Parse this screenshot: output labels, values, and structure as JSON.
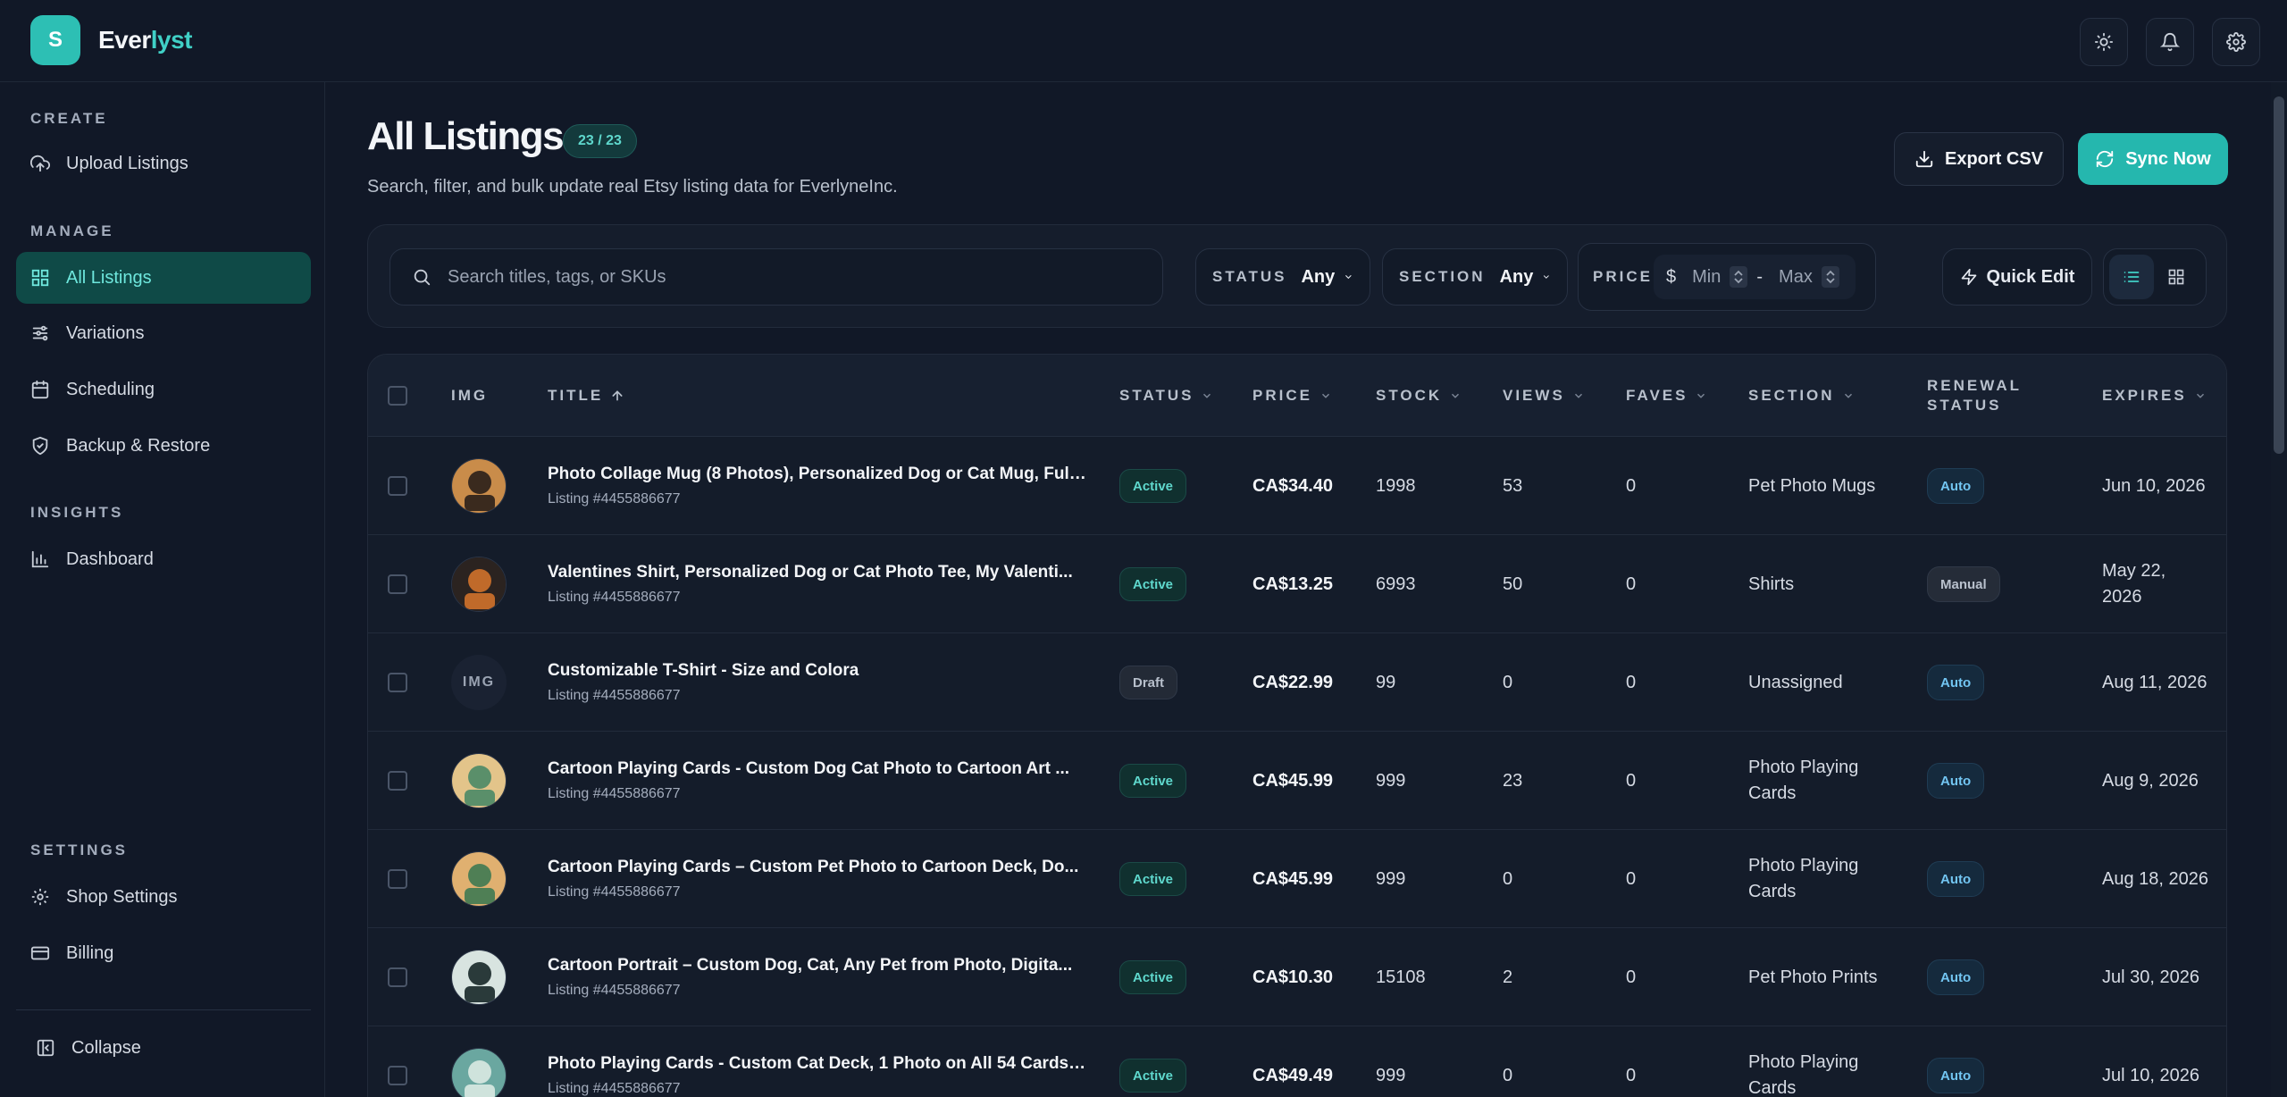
{
  "app": {
    "logo_letter": "S",
    "name_part1": "Ever",
    "name_part2": "lyst"
  },
  "topbar": {
    "icons": [
      "sun-icon",
      "bell-icon",
      "gear-icon"
    ]
  },
  "sidebar": {
    "sections": [
      {
        "heading": "CREATE",
        "items": [
          {
            "label": "Upload Listings",
            "icon": "upload-cloud-icon"
          }
        ]
      },
      {
        "heading": "MANAGE",
        "items": [
          {
            "label": "All Listings",
            "icon": "grid-icon",
            "active": true
          },
          {
            "label": "Variations",
            "icon": "sliders-icon"
          },
          {
            "label": "Scheduling",
            "icon": "calendar-icon"
          },
          {
            "label": "Backup & Restore",
            "icon": "shield-icon"
          }
        ]
      },
      {
        "heading": "INSIGHTS",
        "items": [
          {
            "label": "Dashboard",
            "icon": "bar-chart-icon"
          }
        ]
      },
      {
        "heading": "SETTINGS",
        "items": [
          {
            "label": "Shop Settings",
            "icon": "gear-icon"
          },
          {
            "label": "Billing",
            "icon": "credit-card-icon"
          }
        ]
      }
    ],
    "collapse_label": "Collapse"
  },
  "page": {
    "title": "All Listings",
    "count_badge": "23 / 23",
    "subtitle": "Search, filter, and bulk update real Etsy listing data for EverlyneInc.",
    "export_label": "Export CSV",
    "sync_label": "Sync Now"
  },
  "filters": {
    "search_placeholder": "Search titles, tags, or SKUs",
    "status_label": "STATUS",
    "status_value": "Any",
    "section_label": "SECTION",
    "section_value": "Any",
    "price_label": "PRICE",
    "currency_symbol": "$",
    "min_placeholder": "Min",
    "range_separator": "-",
    "max_placeholder": "Max",
    "quick_edit_label": "Quick Edit"
  },
  "table": {
    "columns": {
      "img": "IMG",
      "title": "TITLE",
      "status": "STATUS",
      "price": "PRICE",
      "stock": "STOCK",
      "views": "VIEWS",
      "faves": "FAVES",
      "section": "SECTION",
      "renewal_line1": "RENEWAL",
      "renewal_line2": "STATUS",
      "expires": "EXPIRES"
    },
    "rows": [
      {
        "img": "",
        "title": "Photo Collage Mug (8 Photos), Personalized Dog or Cat Mug, Full...",
        "listing": "Listing #4455886677",
        "status": "Active",
        "price": "CA$34.40",
        "stock": "1998",
        "views": "53",
        "faves": "0",
        "section": "Pet Photo Mugs",
        "renewal": "Auto",
        "expires": "Jun 10, 2026"
      },
      {
        "img": "",
        "title": "Valentines Shirt, Personalized Dog or Cat Photo Tee, My Valenti...",
        "listing": "Listing #4455886677",
        "status": "Active",
        "price": "CA$13.25",
        "stock": "6993",
        "views": "50",
        "faves": "0",
        "section": "Shirts",
        "renewal": "Manual",
        "expires": "May 22, 2026"
      },
      {
        "img": "IMG",
        "title": "Customizable T-Shirt - Size and Colora",
        "listing": "Listing #4455886677",
        "status": "Draft",
        "price": "CA$22.99",
        "stock": "99",
        "views": "0",
        "faves": "0",
        "section": "Unassigned",
        "renewal": "Auto",
        "expires": "Aug 11, 2026"
      },
      {
        "img": "",
        "title": "Cartoon Playing Cards - Custom Dog Cat Photo to Cartoon Art ...",
        "listing": "Listing #4455886677",
        "status": "Active",
        "price": "CA$45.99",
        "stock": "999",
        "views": "23",
        "faves": "0",
        "section": "Photo Playing Cards",
        "renewal": "Auto",
        "expires": "Aug 9, 2026"
      },
      {
        "img": "",
        "title": "Cartoon Playing Cards – Custom Pet Photo to Cartoon Deck, Do...",
        "listing": "Listing #4455886677",
        "status": "Active",
        "price": "CA$45.99",
        "stock": "999",
        "views": "0",
        "faves": "0",
        "section": "Photo Playing Cards",
        "renewal": "Auto",
        "expires": "Aug 18, 2026"
      },
      {
        "img": "",
        "title": "Cartoon Portrait – Custom Dog, Cat, Any Pet from Photo, Digita...",
        "listing": "Listing #4455886677",
        "status": "Active",
        "price": "CA$10.30",
        "stock": "15108",
        "views": "2",
        "faves": "0",
        "section": "Pet Photo Prints",
        "renewal": "Auto",
        "expires": "Jul 30, 2026"
      },
      {
        "img": "",
        "title": "Photo Playing Cards - Custom Cat Deck, 1 Photo on All 54 Cards,...",
        "listing": "Listing #4455886677",
        "status": "Active",
        "price": "CA$49.49",
        "stock": "999",
        "views": "0",
        "faves": "0",
        "section": "Photo Playing Cards",
        "renewal": "Auto",
        "expires": "Jul 10, 2026"
      }
    ]
  },
  "colors": {
    "background": "#111827",
    "accent": "#2dbfb4",
    "active_nav_bg": "#0f4a47",
    "status_active": "#5fd8cd",
    "renewal_auto": "#72c5f2"
  }
}
